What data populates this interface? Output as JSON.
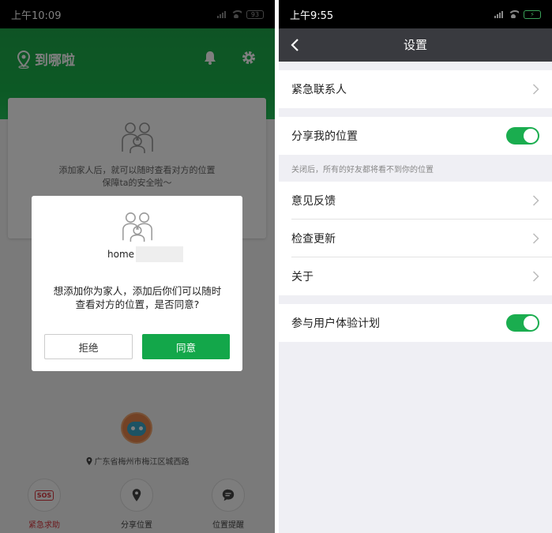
{
  "left_screen": {
    "status_bar": {
      "time": "上午10:09",
      "battery": "93"
    },
    "header": {
      "app_name": "到哪啦"
    },
    "card": {
      "line1": "添加家人后，就可以随时查看对方的位置",
      "line2": "保障ta的安全啦～"
    },
    "dialog": {
      "name": "home",
      "message_line1": "想添加你为家人，添加后你们可以随时",
      "message_line2": "查看对方的位置，是否同意?",
      "reject_label": "拒绝",
      "accept_label": "同意"
    },
    "address": "广东省梅州市梅江区城西路",
    "actions": [
      {
        "label": "紧急求助",
        "badge": "SOS",
        "color": "#d9363e"
      },
      {
        "label": "分享位置"
      },
      {
        "label": "位置提醒"
      }
    ]
  },
  "right_screen": {
    "status_bar": {
      "time": "上午9:55"
    },
    "nav": {
      "title": "设置"
    },
    "rows": {
      "emergency_contact": "紧急联系人",
      "share_location": "分享我的位置",
      "share_hint": "关闭后，所有的好友都将看不到你的位置",
      "feedback": "意见反馈",
      "check_update": "检查更新",
      "about": "关于",
      "ux_program": "参与用户体验计划"
    },
    "toggles": {
      "share_location": true,
      "ux_program": true
    }
  },
  "colors": {
    "brand_green": "#19b34b",
    "accept_green": "#13a74a",
    "nav_dark": "#393a3f",
    "sos_red": "#d9363e"
  }
}
